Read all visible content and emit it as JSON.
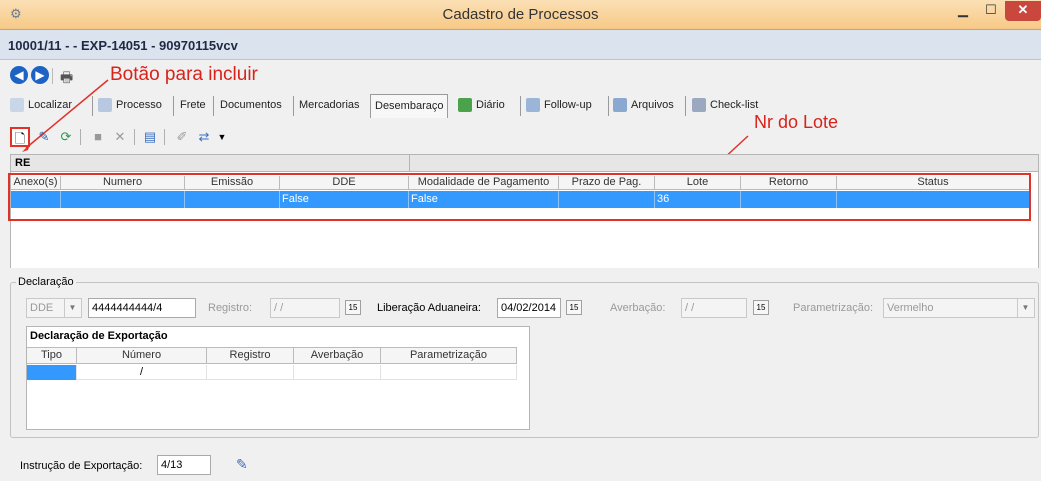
{
  "window": {
    "title": "Cadastro de Processos"
  },
  "process": {
    "header": "10001/11 -  - EXP-14051 - 90970115vcv"
  },
  "annotations": {
    "include_button": "Botão para incluir",
    "lote": "Nr do Lote"
  },
  "tabs": [
    {
      "label": "Localizar"
    },
    {
      "label": "Processo"
    },
    {
      "label": "Frete"
    },
    {
      "label": "Documentos"
    },
    {
      "label": "Mercadorias"
    },
    {
      "label": "Desembaraço"
    },
    {
      "label": "Diário"
    },
    {
      "label": "Follow-up"
    },
    {
      "label": "Arquivos"
    },
    {
      "label": "Check-list"
    }
  ],
  "re_section": {
    "title": "RE"
  },
  "re_grid": {
    "columns": [
      "Anexo(s)",
      "Numero",
      "Emissão",
      "DDE",
      "Modalidade de Pagamento",
      "Prazo de Pag.",
      "Lote",
      "Retorno",
      "Status"
    ],
    "rows": [
      {
        "anexos": "",
        "numero": "",
        "emissao": "",
        "dde": "False",
        "modalidade": "False",
        "prazo": "",
        "lote": "36",
        "retorno": "",
        "status": ""
      }
    ]
  },
  "declaracao": {
    "legend": "Declaração",
    "tipo_value": "DDE",
    "numero_value": "4444444444/4",
    "registro_label": "Registro:",
    "registro_value": "/ /",
    "liberacao_label": "Liberação Aduaneira:",
    "liberacao_value": "04/02/2014",
    "averbacao_label": "Averbação:",
    "averbacao_value": "/ /",
    "parametrizacao_label": "Parametrização:",
    "parametrizacao_value": "Vermelho"
  },
  "export_grid": {
    "title": "Declaração de Exportação",
    "columns": [
      "Tipo",
      "Número",
      "Registro",
      "Averbação",
      "Parametrização"
    ],
    "rows": [
      {
        "tipo": "",
        "numero": "/",
        "registro": "",
        "averbacao": "",
        "parametrizacao": ""
      }
    ]
  },
  "instrucao": {
    "label": "Instrução de Exportação:",
    "value": "4/13"
  },
  "colors": {
    "title_bar": "#f7c987",
    "selection": "#3399ff",
    "annotation_red": "#e03228",
    "nav_blue": "#1e63c4"
  }
}
